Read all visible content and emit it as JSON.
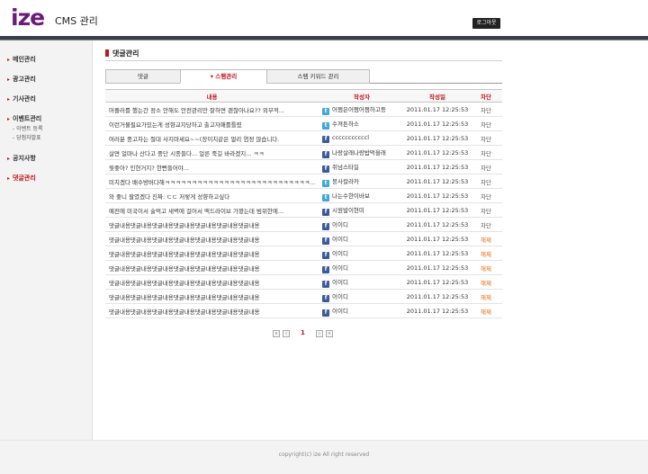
{
  "header": {
    "logo": "ize",
    "title": "CMS 관리",
    "logout_label": "로그아웃"
  },
  "sidebar": {
    "items": [
      {
        "label": "메인관리"
      },
      {
        "label": "광고관리"
      },
      {
        "label": "기사관리"
      },
      {
        "label": "이벤트관리",
        "subitems": [
          "이벤트 등록",
          "당첨자발표"
        ]
      },
      {
        "label": "공지사항"
      },
      {
        "label": "댓글관리"
      }
    ]
  },
  "section": {
    "title": "댓글관리"
  },
  "tabs": [
    {
      "label": "댓글"
    },
    {
      "label": "스팸관리"
    },
    {
      "label": "스팸 키워드 관리"
    }
  ],
  "table": {
    "headers": [
      "내용",
      "작성자",
      "작성일",
      "차단"
    ],
    "rows": [
      {
        "content": "머플러를 했는간 정소 안해도 안전관리만 잘하면 괜찮아나요?? 외부적...",
        "sns": "twitter",
        "author": "어쩜은어쩜어쩜하고등",
        "date": "2011.01.17 12:25:53",
        "action": "차단",
        "action_type": "block"
      },
      {
        "content": "이런거불필요가있는게 성향교지당하고 출고자패를틀렸",
        "sns": "twitter",
        "author": "수져튼하소",
        "date": "2011.01.17 12:25:53",
        "action": "차단",
        "action_type": "block"
      },
      {
        "content": "여러분 중고차는 절대 사지마세요~~(장이치같은 멀리 염정 많습니다.",
        "sns": "facebook",
        "author": "cccccccccccl",
        "date": "2011.01.17 12:25:53",
        "action": "차단",
        "action_type": "block"
      },
      {
        "content": "살면 얼마나 산다고 중단 시종들다... 얼른 죽길 바라겠지... ㅋㅋ",
        "sns": "facebook",
        "author": "나랑살래나랑밥먹을래",
        "date": "2011.01.17 12:25:53",
        "action": "차단",
        "action_type": "block"
      },
      {
        "content": "뭣좋아? 인현거지? 한뻔들어야...",
        "sns": "facebook",
        "author": "쥐넘스타일",
        "date": "2011.01.17 12:25:53",
        "action": "차단",
        "action_type": "block"
      },
      {
        "content": "미치겠다 배수방버다해ㅋㅋㅋㅋㅋㅋㅋㅋㅋㅋㅋㅋㅋㅋㅋㅋㅋㅋㅋㅋㅋㅋㅋㅋㅋㅋㅋㅋㅋㅋㅋㅋ",
        "sns": "twitter",
        "author": "붕사칼라카",
        "date": "2011.01.17 12:25:53",
        "action": "차단",
        "action_type": "block"
      },
      {
        "content": "와 좋니 팔였겠다 진짜: ㄷㄷ 저렇게 성향하고싶다",
        "sns": "twitter",
        "author": "나는수한이바보",
        "date": "2011.01.17 12:25:53",
        "action": "차단",
        "action_type": "block"
      },
      {
        "content": "예전에 미국이서 술먹고 새벽에 걸어서 맥드라이브 가봤는데 빔위한에...",
        "sns": "facebook",
        "author": "시원발이현미",
        "date": "2011.01.17 12:25:53",
        "action": "차단",
        "action_type": "block"
      },
      {
        "content": "댓글내용댓글내용댓글내용댓글내용댓글내용댓글내용댓글내용",
        "sns": "facebook",
        "author": "이이디",
        "date": "2011.01.17 12:25:53",
        "action": "차단",
        "action_type": "block"
      },
      {
        "content": "댓글내용댓글내용댓글내용댓글내용댓글내용댓글내용댓글내용",
        "sns": "facebook",
        "author": "이이디",
        "date": "2011.01.17 12:25:53",
        "action": "해제",
        "action_type": "release"
      },
      {
        "content": "댓글내용댓글내용댓글내용댓글내용댓글내용댓글내용댓글내용",
        "sns": "facebook",
        "author": "이이디",
        "date": "2011.01.17 12:25:53",
        "action": "해제",
        "action_type": "release"
      },
      {
        "content": "댓글내용댓글내용댓글내용댓글내용댓글내용댓글내용댓글내용",
        "sns": "facebook",
        "author": "이이디",
        "date": "2011.01.17 12:25:53",
        "action": "해제",
        "action_type": "release"
      },
      {
        "content": "댓글내용댓글내용댓글내용댓글내용댓글내용댓글내용댓글내용",
        "sns": "facebook",
        "author": "이이디",
        "date": "2011.01.17 12:25:53",
        "action": "해제",
        "action_type": "release"
      },
      {
        "content": "댓글내용댓글내용댓글내용댓글내용댓글내용댓글내용댓글내용",
        "sns": "facebook",
        "author": "이이디",
        "date": "2011.01.17 12:25:53",
        "action": "해제",
        "action_type": "release"
      },
      {
        "content": "댓글내용댓글내용댓글내용댓글내용댓글내용댓글내용댓글내용",
        "sns": "facebook",
        "author": "이이디",
        "date": "2011.01.17 12:25:53",
        "action": "해제",
        "action_type": "release"
      }
    ]
  },
  "pagination": {
    "first": "«",
    "prev": "‹",
    "current": "1",
    "next": "›",
    "last": "»"
  },
  "footer": {
    "copyright": "copyright(c) ize All right reserved"
  },
  "colors": {
    "accent": "#c0161d",
    "brand": "#6b1b7a",
    "release": "#e06a12"
  }
}
